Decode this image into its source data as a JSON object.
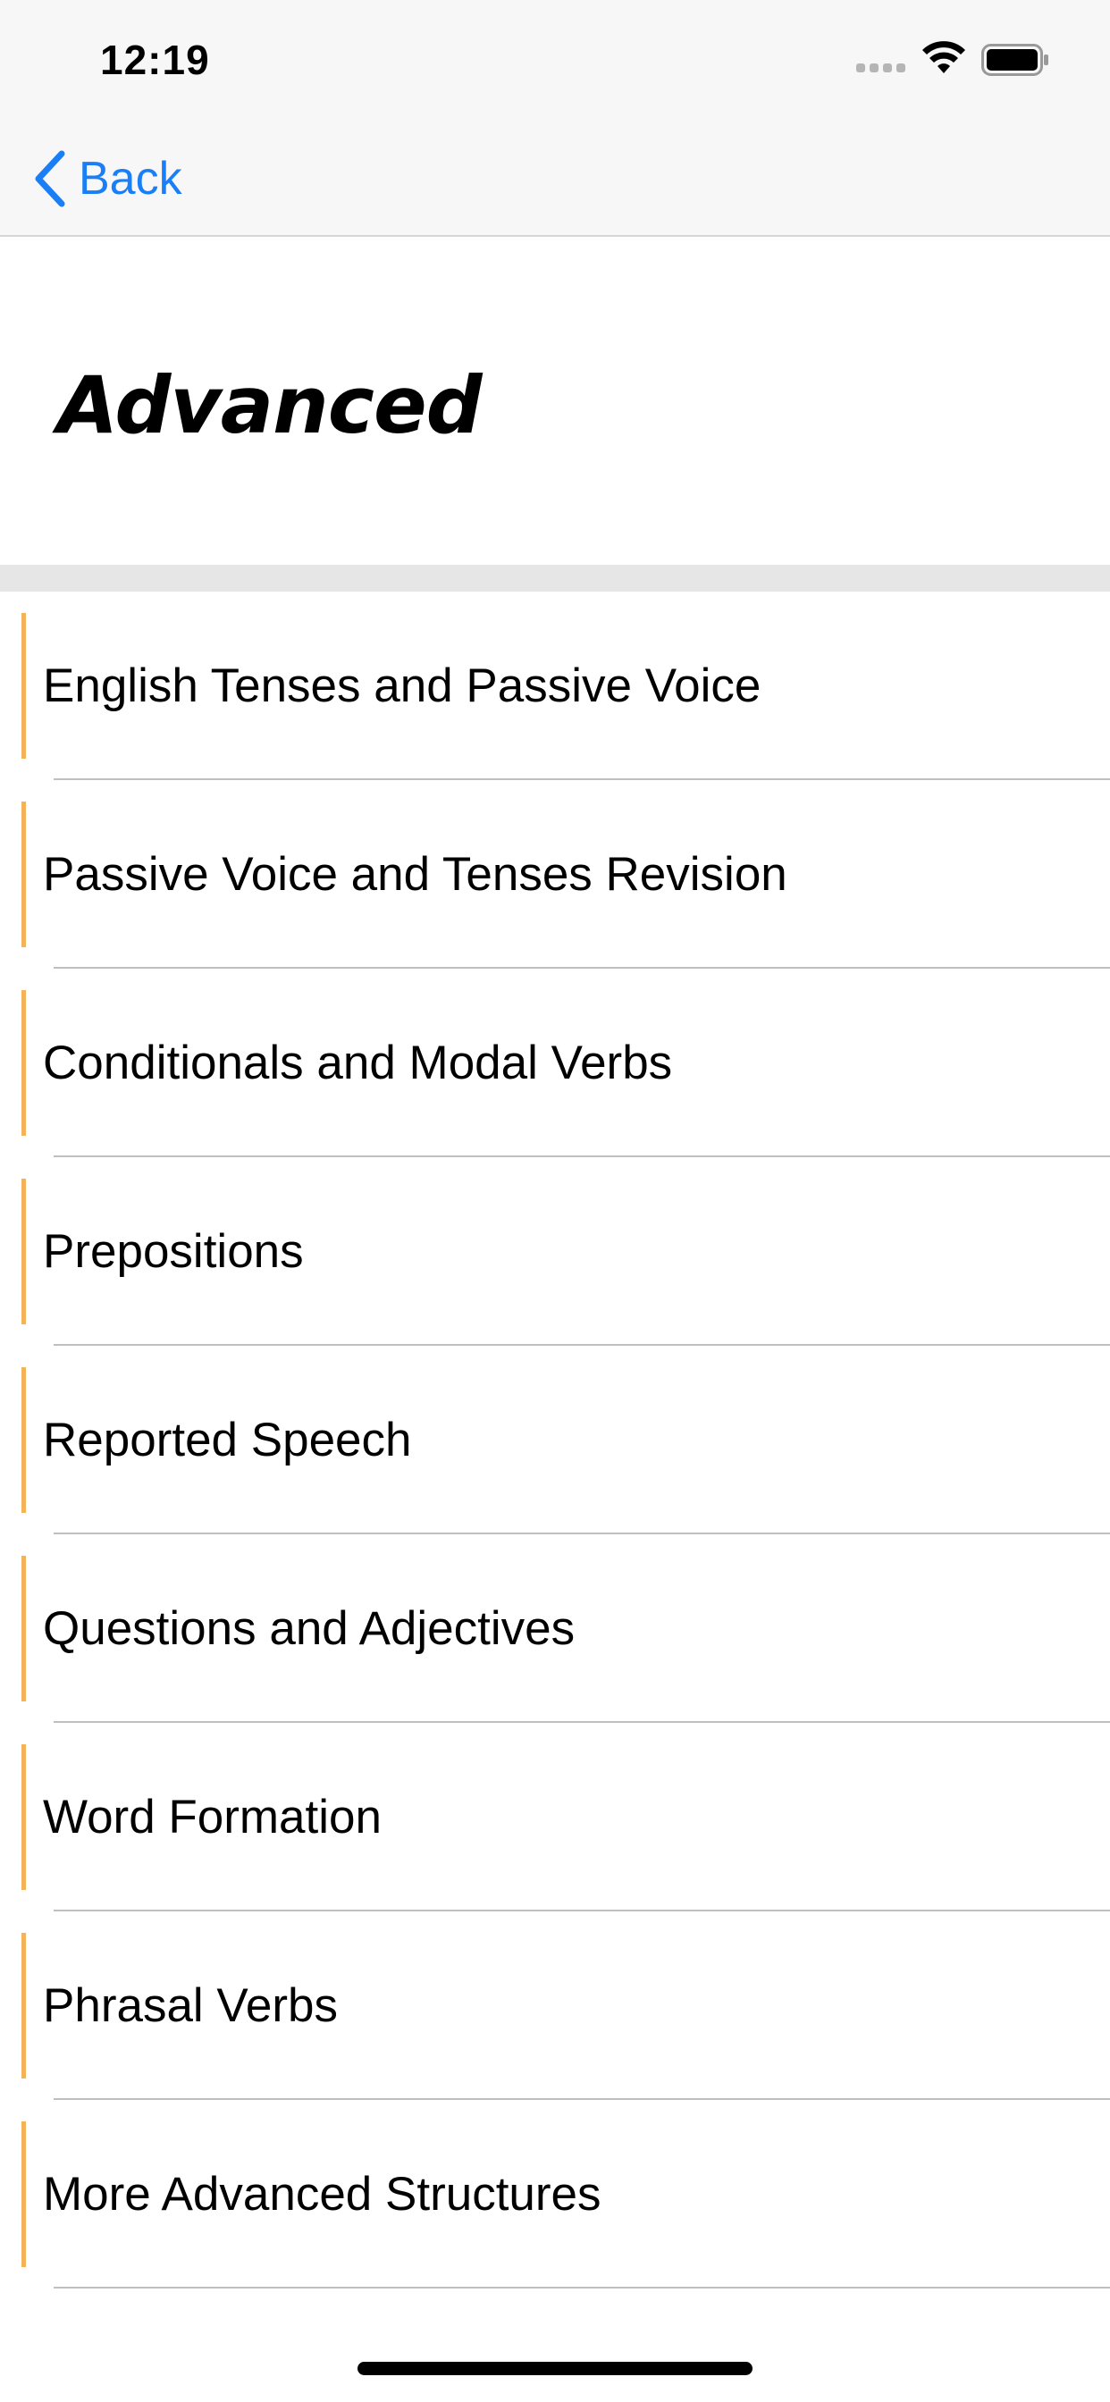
{
  "status_bar": {
    "time": "12:19",
    "icons": [
      "signal-icon",
      "wifi-icon",
      "battery-icon"
    ]
  },
  "nav": {
    "back_label": "Back",
    "accent_color": "#1a7ff6"
  },
  "header": {
    "title": "Advanced"
  },
  "list": {
    "accent_color": "#f4b35a",
    "items": [
      {
        "label": "English Tenses and Passive Voice"
      },
      {
        "label": "Passive Voice and Tenses Revision"
      },
      {
        "label": "Conditionals and Modal Verbs"
      },
      {
        "label": "Prepositions"
      },
      {
        "label": "Reported Speech"
      },
      {
        "label": "Questions and Adjectives"
      },
      {
        "label": "Word Formation"
      },
      {
        "label": "Phrasal Verbs"
      },
      {
        "label": "More Advanced Structures"
      }
    ]
  }
}
